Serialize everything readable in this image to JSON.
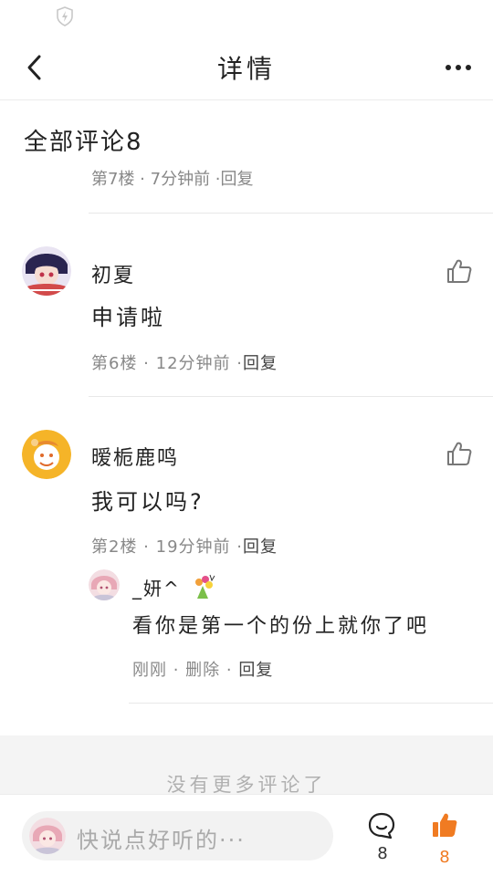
{
  "header": {
    "title": "详情"
  },
  "section": {
    "title": "全部评论8"
  },
  "clipped_meta": "第7楼 · 7分钟前 ·回复",
  "comments": [
    {
      "username": "初夏",
      "text": "申请啦",
      "floor": "第6楼",
      "time": "12分钟前",
      "reply": "回复"
    },
    {
      "username": "暧栀鹿鸣",
      "text": "我可以吗?",
      "floor": "第2楼",
      "time": "19分钟前",
      "reply": "回复",
      "sub_reply": {
        "username": "_妍^",
        "text": "看你是第一个的份上就你了吧",
        "time": "刚刚",
        "delete": "删除",
        "reply": "回复"
      }
    }
  ],
  "no_more": "没有更多评论了",
  "bottom_bar": {
    "placeholder": "快说点好听的···",
    "comment_count": "8",
    "like_count": "8",
    "accent_color": "#f07b22"
  }
}
